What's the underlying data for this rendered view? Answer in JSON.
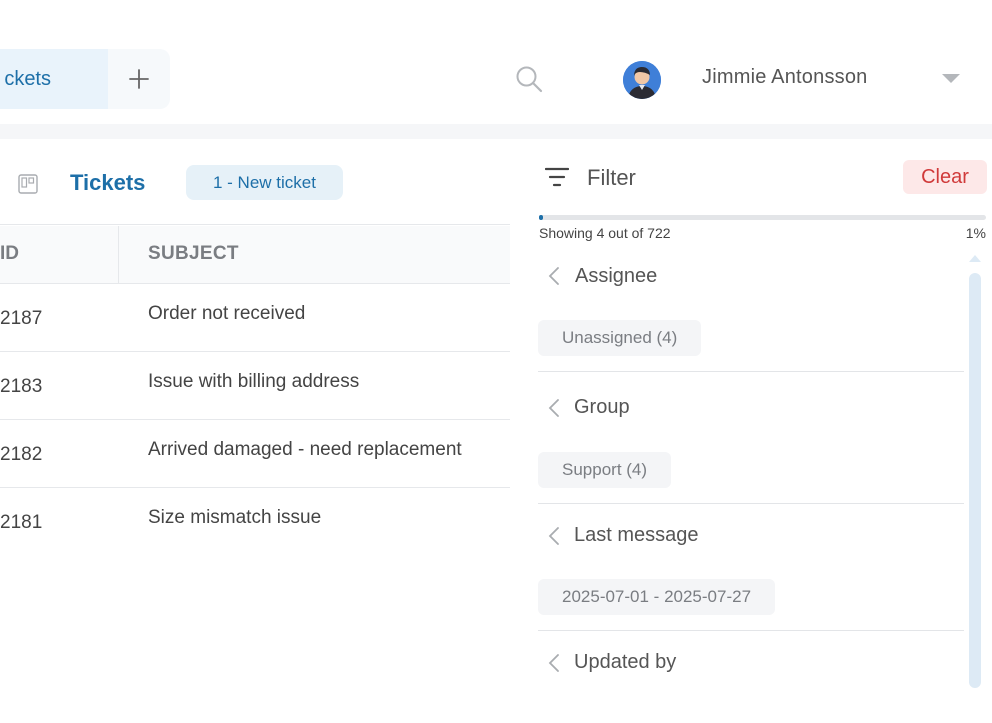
{
  "tabs": {
    "active_label": "ckets"
  },
  "user": {
    "name": "Jimmie Antonsson"
  },
  "tickets": {
    "title": "Tickets",
    "new_badge": "1 - New ticket",
    "columns": {
      "id": "ID",
      "subject": "SUBJECT"
    },
    "rows": [
      {
        "id": "2187",
        "subject": "Order not received"
      },
      {
        "id": "2183",
        "subject": "Issue with billing address"
      },
      {
        "id": "2182",
        "subject": "Arrived damaged - need replacement"
      },
      {
        "id": "2181",
        "subject": "Size mismatch issue"
      }
    ]
  },
  "filter": {
    "title": "Filter",
    "clear_label": "Clear",
    "showing": "Showing 4 out of 722",
    "percent": "1%",
    "progress_fraction": 0.01,
    "sections": [
      {
        "label": "Assignee",
        "chip": "Unassigned (4)"
      },
      {
        "label": "Group",
        "chip": "Support (4)"
      },
      {
        "label": "Last message",
        "chip": "2025-07-01 - 2025-07-27"
      },
      {
        "label": "Updated by"
      }
    ]
  },
  "colors": {
    "accent": "#1d6fa8",
    "clear": "#d03a3a",
    "clear_bg": "#fde8e8",
    "badge_bg": "#e6f1f8"
  },
  "icons": [
    "plus-icon",
    "search-icon",
    "chevron-down-icon",
    "board-icon",
    "filter-lines-icon",
    "chevron-left-icon",
    "scroll-up-icon"
  ]
}
